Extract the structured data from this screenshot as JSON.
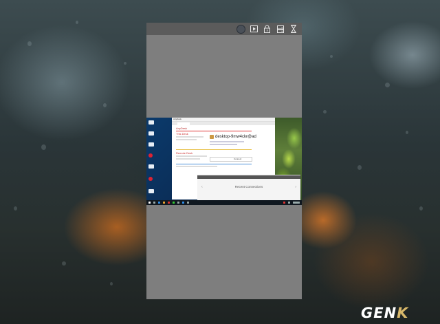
{
  "phone": {
    "toolbar_icons": [
      "avatar-icon",
      "play-icon",
      "lock-icon",
      "storage-icon",
      "hourglass-icon"
    ]
  },
  "remote_desktop": {
    "app_title": "AnyDesk",
    "this_desk": {
      "title": "This Desk",
      "address": "desktop-9mw4ckr@ad"
    },
    "remote_desk": {
      "title": "Remote Desk",
      "connect_label": "Connect"
    },
    "bottom_panel": {
      "label": "Recent Connections"
    }
  },
  "logo": {
    "text_main": "GEN",
    "text_accent": "K"
  },
  "colors": {
    "phone_bg": "#7e7e7e",
    "phone_toolbar": "#5b5b5b",
    "logo_accent": "#d8b86a"
  }
}
